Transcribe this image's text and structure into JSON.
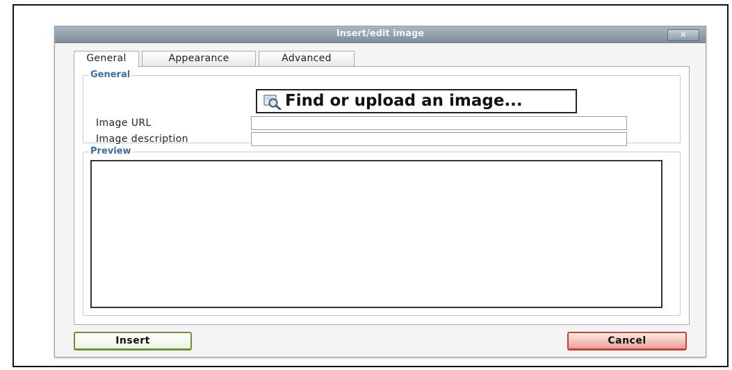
{
  "dialog": {
    "title": "Insert/edit image",
    "close_label": "✕"
  },
  "tabs": [
    {
      "label": "General",
      "active": true
    },
    {
      "label": "Appearance",
      "active": false
    },
    {
      "label": "Advanced",
      "active": false
    }
  ],
  "general": {
    "legend": "General",
    "find_button_label": "Find or upload an image...",
    "find_icon": "search-image-icon",
    "image_url_label": "Image URL",
    "image_url_value": "",
    "image_description_label": "Image description",
    "image_description_value": ""
  },
  "preview": {
    "legend": "Preview"
  },
  "footer": {
    "insert_label": "Insert",
    "cancel_label": "Cancel"
  },
  "colors": {
    "legend": "#3a6ea5",
    "insert_border": "#6f8f3a",
    "cancel_border": "#c0443a",
    "titlebar": "#8f9ca9"
  }
}
